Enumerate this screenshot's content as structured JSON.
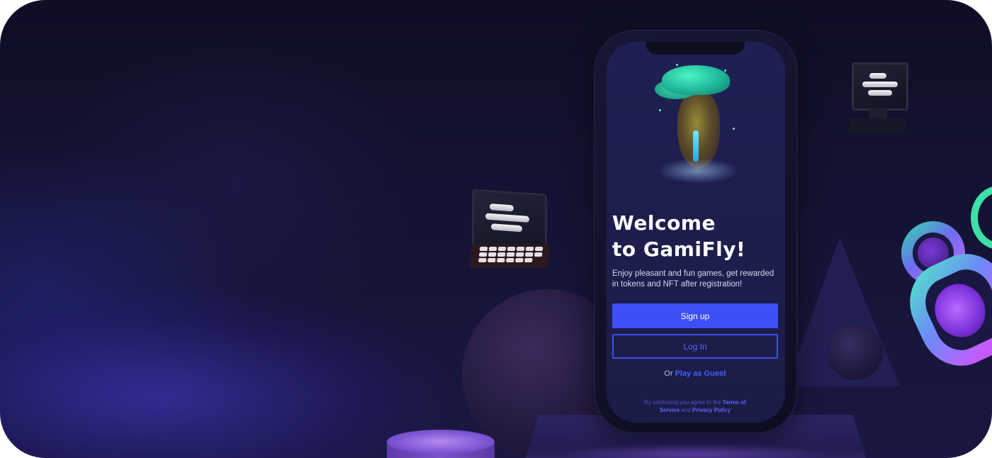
{
  "app": {
    "name": "GamiFly"
  },
  "welcome": {
    "line1": "Welcome",
    "line2": "to GamiFly!"
  },
  "description": "Enjoy pleasant and fun games, get rewarded in tokens and NFT after registration!",
  "buttons": {
    "signup_label": "Sign up",
    "login_label": "Log In"
  },
  "guest": {
    "prefix": "Or",
    "link_label": "Play as Guest"
  },
  "terms": {
    "prefix": "By continuing you agree to the",
    "terms_link": "Terms of Service",
    "conjunction": "and",
    "privacy_link": "Privacy Policy"
  },
  "colors": {
    "primary_button": "#3d4ff6",
    "link": "#4a5cff",
    "screen_bg": "#1f2052",
    "page_bg": "#141232"
  },
  "icons": [
    "laptop-icon",
    "monitor-icon",
    "floating-island-illustration"
  ]
}
